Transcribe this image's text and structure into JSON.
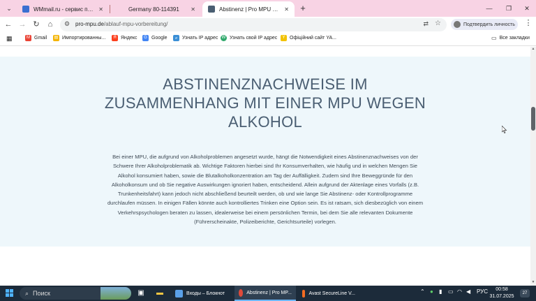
{
  "browser": {
    "tabs": [
      {
        "title": "WMmail.ru - сервис почтовых",
        "favicon_color": "#3b6fd1",
        "active": false
      },
      {
        "title": "Germany 80-114391",
        "favicon_color": "#f8d3e4",
        "active": false
      },
      {
        "title": "Abstinenz | Pro MPU Dresden",
        "favicon_color": "#4a5e72",
        "active": true
      }
    ],
    "address": {
      "domain": "pro-mpu.de",
      "path": "/ablauf-mpu-vorbereitung/"
    },
    "profile_button": "Подтвердить личность",
    "bookmarks": [
      {
        "label": "Gmail",
        "icon_color": "#ea4335",
        "icon_text": "M"
      },
      {
        "label": "Импортированны...",
        "icon_color": "#f4b400",
        "icon_text": "▤"
      },
      {
        "label": "Яндекс",
        "icon_color": "#fc3f1d",
        "icon_text": "Я"
      },
      {
        "label": "Google",
        "icon_color": "#4285f4",
        "icon_text": "G"
      },
      {
        "label": "Узнать IP адрес",
        "icon_color": "#3b8fd6",
        "icon_text": "IP"
      },
      {
        "label": "Узнать свой IP адрес",
        "icon_color": "#2fa86b",
        "icon_text": "W"
      },
      {
        "label": "Офіційний сайт YA...",
        "icon_color": "#f2c200",
        "icon_text": "Y"
      }
    ],
    "all_bookmarks": "Все закладки"
  },
  "page": {
    "heading": "ABSTINENZNACHWEISE IM ZUSAMMENHANG MIT EINER MPU WEGEN ALKOHOL",
    "paragraph": "Bei einer MPU, die aufgrund von Alkoholproblemen angesetzt wurde, hängt die Notwendigkeit eines Abstinenznachweises von der Schwere Ihrer Alkoholproblematik ab. Wichtige Faktoren hierbei sind Ihr Konsumverhalten, wie häufig und in welchen Mengen Sie Alkohol konsumiert haben, sowie die Blutalkoholkonzentration am Tag der Auffälligkeit. Zudem sind Ihre Beweggründe für den Alkoholkonsum und ob Sie negative Auswirkungen ignoriert haben, entscheidend. Allein aufgrund der Aktenlage eines Vorfalls (z.B. Trunkenheitsfahrt) kann jedoch nicht abschließend beurteilt werden, ob und wie lange Sie Abstinenz- oder Kontrollprogramme durchlaufen müssen. In einigen Fällen könnte auch kontrolliertes Trinken eine Option sein. Es ist ratsam, sich diesbezüglich von einem Verkehrspsychologen beraten zu lassen, idealerweise bei einem persönlichen Termin, bei dem Sie alle relevanten Dokumente (Führerscheinakte, Polizeiberichte, Gerichtsurteile) vorlegen."
  },
  "taskbar": {
    "search_placeholder": "Поиск",
    "apps": [
      {
        "label": "Входы – Блокнот",
        "icon_color": "#5aa0e8",
        "active": false
      },
      {
        "label": "Abstinenz | Pro MP...",
        "icon_color": "#e04a3a",
        "active": true
      },
      {
        "label": "Avast SecureLine V...",
        "icon_color": "#f26b22",
        "active": false
      }
    ],
    "language": "РУС",
    "time": "00:58",
    "date": "31.07.2025",
    "notification_count": "27"
  }
}
